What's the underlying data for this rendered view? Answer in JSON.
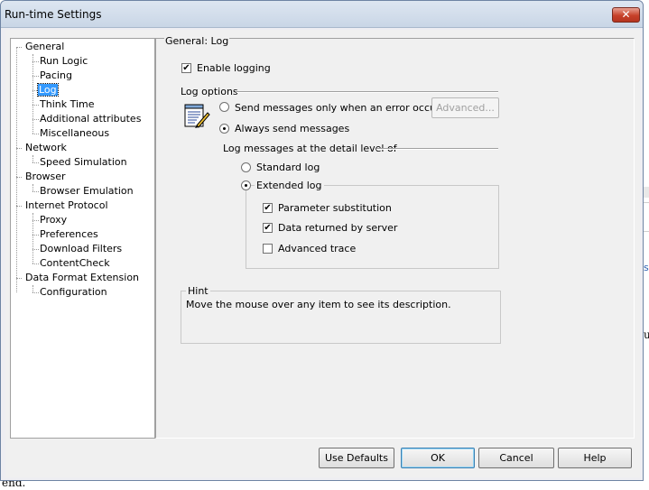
{
  "window": {
    "title": "Run-time Settings",
    "close_label": "✕"
  },
  "tree": [
    {
      "label": "General"
    },
    {
      "label": "Run Logic"
    },
    {
      "label": "Pacing"
    },
    {
      "label": "Log"
    },
    {
      "label": "Think Time"
    },
    {
      "label": "Additional attributes"
    },
    {
      "label": "Miscellaneous"
    },
    {
      "label": "Network"
    },
    {
      "label": "Speed Simulation"
    },
    {
      "label": "Browser"
    },
    {
      "label": "Browser Emulation"
    },
    {
      "label": "Internet Protocol"
    },
    {
      "label": "Proxy"
    },
    {
      "label": "Preferences"
    },
    {
      "label": "Download Filters"
    },
    {
      "label": "ContentCheck"
    },
    {
      "label": "Data Format Extension"
    },
    {
      "label": "Configuration"
    }
  ],
  "selected_item": "Log",
  "panel": {
    "header": "General: Log",
    "enable_logging": {
      "label": "Enable logging",
      "checked": true
    },
    "log_options_label": "Log options",
    "send_on_error": {
      "label": "Send messages only when an error occurs",
      "selected": false
    },
    "advanced_button": "Advanced...",
    "always_send": {
      "label": "Always send messages",
      "selected": true
    },
    "detail_level_label": "Log messages at the detail level of",
    "standard_log": {
      "label": "Standard log",
      "selected": false
    },
    "extended_log": {
      "label": "Extended log",
      "selected": true
    },
    "parameter_substitution": {
      "label": "Parameter substitution",
      "checked": true
    },
    "data_returned": {
      "label": "Data returned by server",
      "checked": true
    },
    "advanced_trace": {
      "label": "Advanced trace",
      "checked": false
    },
    "hint_label": "Hint",
    "hint_text": "Move the mouse over any item to see its description."
  },
  "buttons": {
    "use_defaults": "Use Defaults",
    "ok": "OK",
    "cancel": "Cancel",
    "help": "Help"
  },
  "background": {
    "bottom_text": "end.",
    "right_s": "s",
    "right_u": "u"
  }
}
